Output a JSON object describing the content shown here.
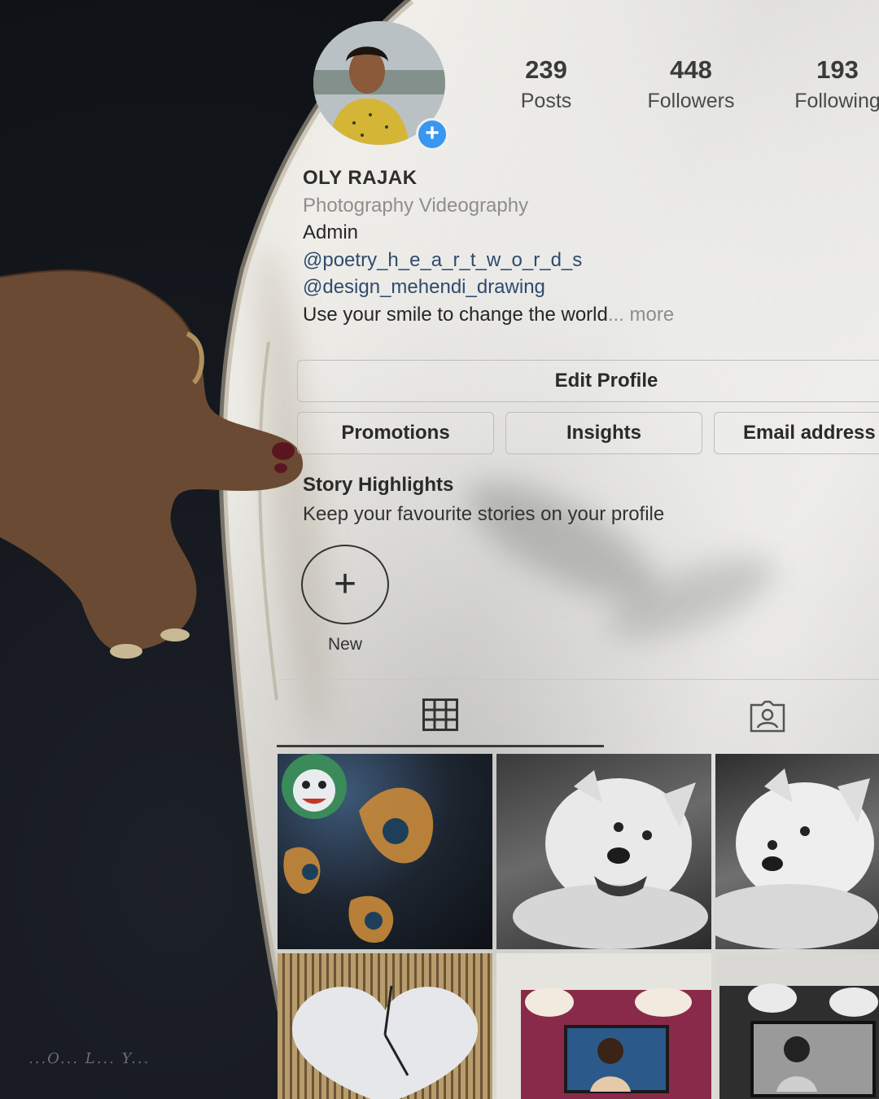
{
  "profile": {
    "name": "OLY RAJAK",
    "category": "Photography Videography",
    "role": "Admin",
    "links": [
      "@poetry_h_e_a_r_t_w_o_r_d_s",
      "@design_mehendi_drawing"
    ],
    "bio": "Use your smile to change the world",
    "more": "... more"
  },
  "stats": [
    {
      "value": "239",
      "label": "Posts"
    },
    {
      "value": "448",
      "label": "Followers"
    },
    {
      "value": "193",
      "label": "Following"
    }
  ],
  "buttons": {
    "edit_profile": "Edit Profile",
    "promotions": "Promotions",
    "insights": "Insights",
    "email": "Email address"
  },
  "highlights": {
    "title": "Story Highlights",
    "subtitle": "Keep your favourite stories on your profile",
    "new_label": "New",
    "new_icon": "plus-icon"
  },
  "tabs": {
    "grid_icon": "grid-icon",
    "tagged_icon": "tagged-person-icon"
  },
  "colors": {
    "accent_blue": "#3897f0",
    "link": "#2f4b6e",
    "muted": "#8e8e8e"
  },
  "signature": "...O... L... Y..."
}
